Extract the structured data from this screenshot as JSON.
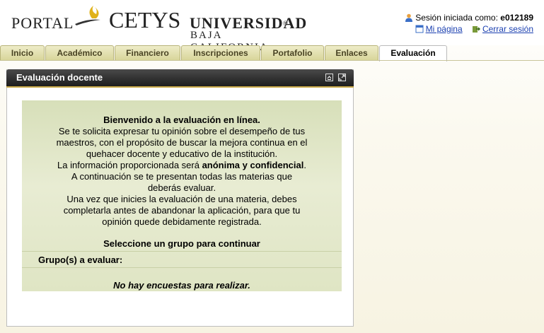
{
  "header": {
    "logo": {
      "portal": "PORTAL",
      "cetys": "CETYS",
      "universidad": "UNIVERSIDAD",
      "registered": "®",
      "baja": "BAJA CALIFORNIA"
    },
    "session": {
      "prefix": "Sesión iniciada como:",
      "user": "e012189",
      "my_page": "Mi página",
      "logout": "Cerrar sesión"
    }
  },
  "tabs": [
    {
      "label": "Inicio"
    },
    {
      "label": "Académico"
    },
    {
      "label": "Financiero"
    },
    {
      "label": "Inscripciones"
    },
    {
      "label": "Portafolio"
    },
    {
      "label": "Enlaces"
    },
    {
      "label": "Evaluación"
    }
  ],
  "active_tab": "Evaluación",
  "panel": {
    "title": "Evaluación docente",
    "welcome_title": "Bienvenido a la evaluación en línea.",
    "intro_1": "Se te solicita expresar tu opinión sobre el desempeño de tus",
    "intro_2": "maestros, con el propósito de buscar la mejora continua en el",
    "intro_3": "quehacer docente y educativo de la institución.",
    "intro_4a": "La información proporcionada será ",
    "intro_4b": "anónima y confidencial",
    "intro_4c": ".",
    "intro_5": "A continuación se te presentan todas las materias que",
    "intro_6": "deberás evaluar.",
    "intro_7": "Una vez que inicies la evaluación de una materia, debes",
    "intro_8": "completarla antes de abandonar la aplicación, para que tu",
    "intro_9": "opinión quede debidamente registrada.",
    "select_title": "Seleccione un grupo para continuar",
    "groups_label": "Grupo(s) a evaluar:",
    "no_surveys": "No hay encuestas para realizar."
  },
  "colors": {
    "panel_header": "#2b2b2b",
    "panel_accent": "#c9a94a",
    "box_bg": "#e3e8c9",
    "link": "#1a3fb0"
  }
}
